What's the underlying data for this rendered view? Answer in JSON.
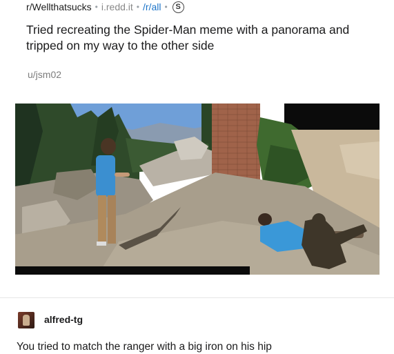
{
  "post": {
    "subreddit": "r/Wellthatsucks",
    "domain": "i.redd.it",
    "crosspost_from": "/r/all",
    "badge": "S",
    "title": "Tried recreating the Spider-Man meme with a panorama and tripped on my way to the other side",
    "author": "u/jsm02",
    "image_icon": "panorama-photo"
  },
  "comment": {
    "username": "alfred-tg",
    "avatar_icon": "user-avatar",
    "text": "You tried to match the ranger with a big iron on his hip"
  },
  "colors": {
    "link": "#1a73c8",
    "muted": "#888888",
    "text": "#1a1a1b"
  }
}
